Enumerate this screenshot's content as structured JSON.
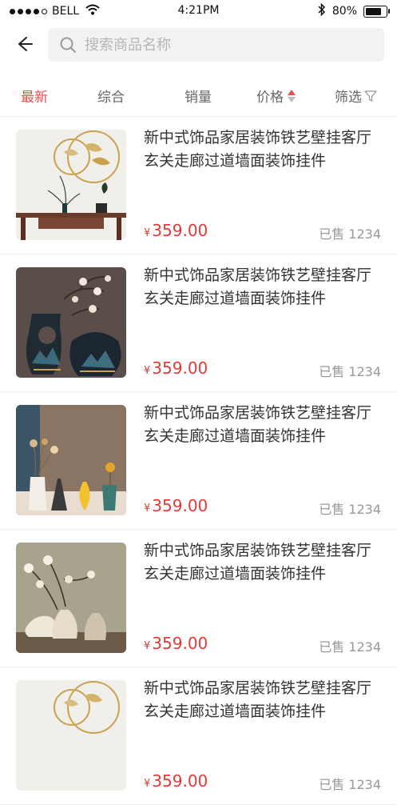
{
  "status": {
    "carrier": "BELL",
    "time": "4:21PM",
    "battery": "80%",
    "battery_level": 0.8
  },
  "search": {
    "placeholder": "搜索商品名称"
  },
  "filters": {
    "latest": "最新",
    "overall": "综合",
    "sales": "销量",
    "price": "价格",
    "filter": "筛选",
    "active": "latest",
    "active_color": "#f24d4d"
  },
  "products": [
    {
      "title": "新中式饰品家居装饰铁艺壁挂客厅玄关走廊过道墙面装饰挂件",
      "currency": "¥",
      "price": "359.00",
      "sold": "已售 1234",
      "image": "wall-decor"
    },
    {
      "title": "新中式饰品家居装饰铁艺壁挂客厅玄关走廊过道墙面装饰挂件",
      "currency": "¥",
      "price": "359.00",
      "sold": "已售 1234",
      "image": "vase-plum"
    },
    {
      "title": "新中式饰品家居装饰铁艺壁挂客厅玄关走廊过道墙面装饰挂件",
      "currency": "¥",
      "price": "359.00",
      "sold": "已售 1234",
      "image": "dried-flowers"
    },
    {
      "title": "新中式饰品家居装饰铁艺壁挂客厅玄关走廊过道墙面装饰挂件",
      "currency": "¥",
      "price": "359.00",
      "sold": "已售 1234",
      "image": "ceramic-vases"
    },
    {
      "title": "新中式饰品家居装饰铁艺壁挂客厅玄关走廊过道墙面装饰挂件",
      "currency": "¥",
      "price": "359.00",
      "sold": "已售 1234",
      "image": "wall-decor"
    }
  ],
  "colors": {
    "accent": "#f24d4d",
    "price": "#e53935"
  }
}
